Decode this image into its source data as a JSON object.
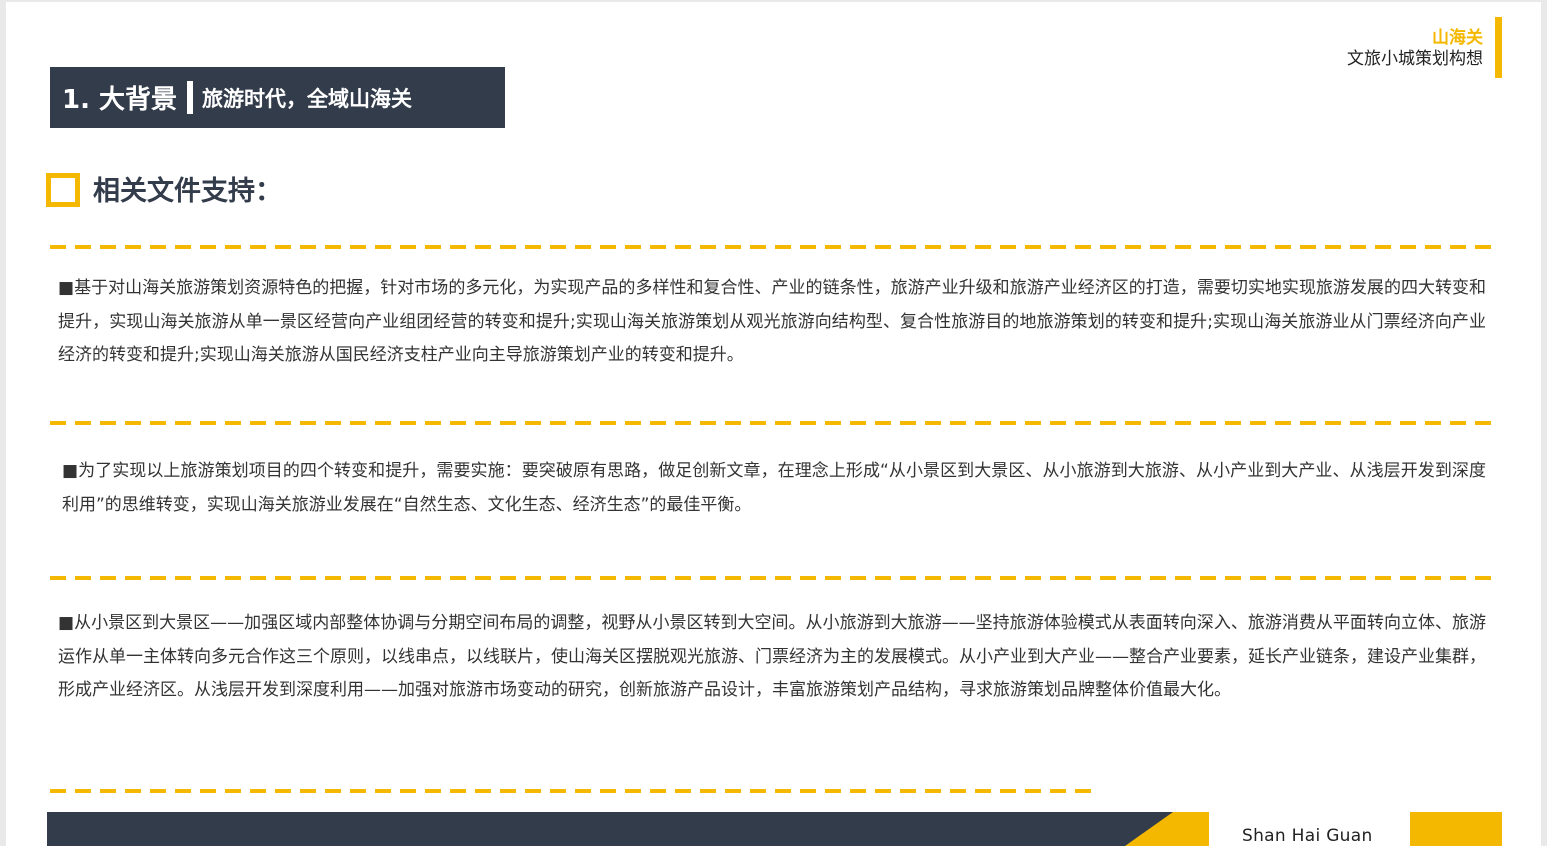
{
  "brand": {
    "name": "山海关",
    "subtitle": "文旅小城策划构想"
  },
  "banner": {
    "main": "1. 大背景",
    "sub": "旅游时代，全域山海关"
  },
  "section": {
    "title": "相关文件支持："
  },
  "paragraphs": [
    "■基于对山海关旅游策划资源特色的把握，针对市场的多元化，为实现产品的多样性和复合性、产业的链条性，旅游产业升级和旅游产业经济区的打造，需要切实地实现旅游发展的四大转变和提升，实现山海关旅游从单一景区经营向产业组团经营的转变和提升;实现山海关旅游策划从观光旅游向结构型、复合性旅游目的地旅游策划的转变和提升;实现山海关旅游业从门票经济向产业经济的转变和提升;实现山海关旅游从国民经济支柱产业向主导旅游策划产业的转变和提升。",
    "■为了实现以上旅游策划项目的四个转变和提升，需要实施：要突破原有思路，做足创新文章，在理念上形成“从小景区到大景区、从小旅游到大旅游、从小产业到大产业、从浅层开发到深度利用”的思维转变，实现山海关旅游业发展在“自然生态、文化生态、经济生态”的最佳平衡。",
    "■从小景区到大景区——加强区域内部整体协调与分期空间布局的调整，视野从小景区转到大空间。从小旅游到大旅游——坚持旅游体验模式从表面转向深入、旅游消费从平面转向立体、旅游运作从单一主体转向多元合作这三个原则，以线串点，以线联片，使山海关区摆脱观光旅游、门票经济为主的发展模式。从小产业到大产业——整合产业要素，延长产业链条，建设产业集群，形成产业经济区。从浅层开发到深度利用——加强对旅游市场变动的研究，创新旅游产品设计，丰富旅游策划产品结构，寻求旅游策划品牌整体价值最大化。"
  ],
  "footer": {
    "text": "Shan Hai Guan"
  },
  "colors": {
    "accent": "#f5b800",
    "dark": "#333c4b"
  }
}
